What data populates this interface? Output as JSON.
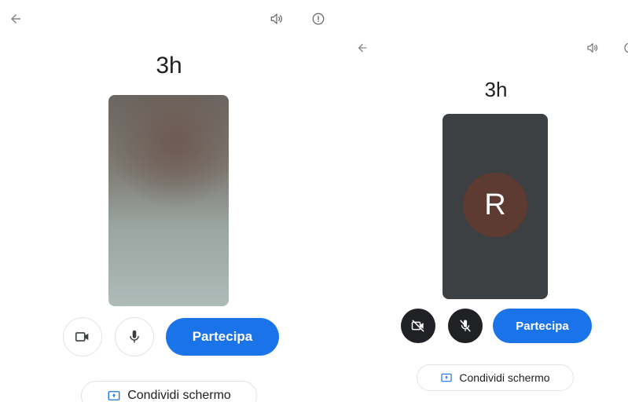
{
  "screen_left": {
    "title": "3h",
    "back_icon": "arrow-back-icon",
    "speaker_icon": "volume-icon",
    "info_icon": "info-icon",
    "camera_state": "on",
    "mic_state": "on",
    "join_label": "Partecipa",
    "share_label": "Condividi schermo",
    "accent_color": "#1a73e8"
  },
  "screen_right": {
    "title": "3h",
    "back_icon": "arrow-back-icon",
    "speaker_icon": "volume-icon",
    "info_icon": "info-icon",
    "avatar_initial": "R",
    "avatar_color": "#5d3a32",
    "camera_state": "off",
    "mic_state": "off",
    "join_label": "Partecipa",
    "share_label": "Condividi schermo",
    "accent_color": "#1a73e8"
  }
}
